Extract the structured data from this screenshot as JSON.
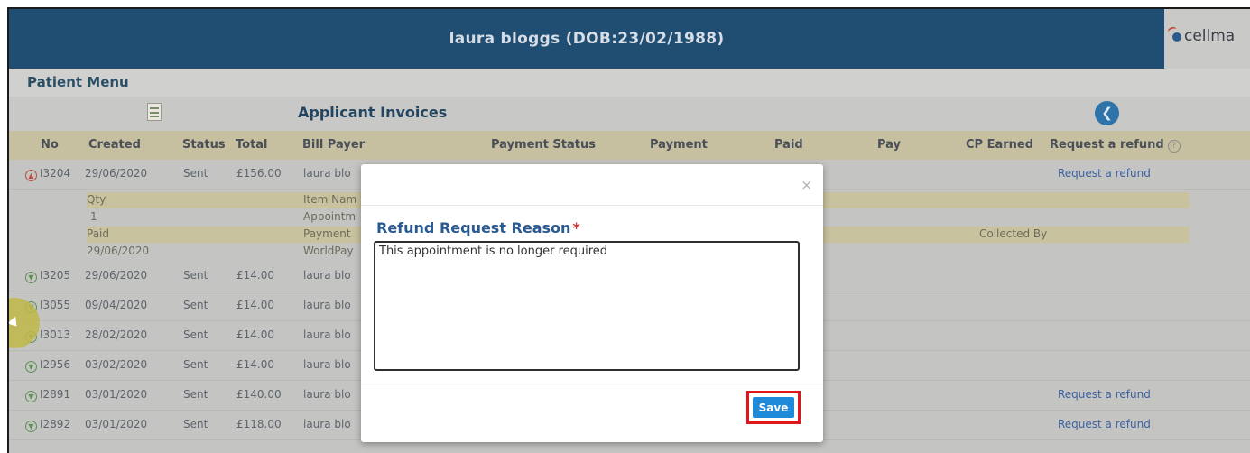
{
  "header": {
    "patient_title": "laura bloggs (DOB:23/02/1988)",
    "logo_text": "cellma"
  },
  "menu": {
    "title": "Patient Menu"
  },
  "invoices": {
    "title": "Applicant Invoices",
    "columns": [
      "No",
      "Created",
      "Status",
      "Total",
      "Bill Payer",
      "Payment Status",
      "Payment",
      "Paid",
      "Pay",
      "CP Earned",
      "Request a refund"
    ],
    "rows": [
      {
        "no": "I3204",
        "created": "29/06/2020",
        "status": "Sent",
        "total": "£156.00",
        "payer": "laura blo",
        "refund": "Request a refund",
        "expanded": true
      },
      {
        "no": "I3205",
        "created": "29/06/2020",
        "status": "Sent",
        "total": "£14.00",
        "payer": "laura blo",
        "refund": ""
      },
      {
        "no": "I3055",
        "created": "09/04/2020",
        "status": "Sent",
        "total": "£14.00",
        "payer": "laura blo",
        "refund": ""
      },
      {
        "no": "I3013",
        "created": "28/02/2020",
        "status": "Sent",
        "total": "£14.00",
        "payer": "laura blo",
        "refund": ""
      },
      {
        "no": "I2956",
        "created": "03/02/2020",
        "status": "Sent",
        "total": "£14.00",
        "payer": "laura blo",
        "refund": ""
      },
      {
        "no": "I2891",
        "created": "03/01/2020",
        "status": "Sent",
        "total": "£140.00",
        "payer": "laura blo",
        "refund": "Request a refund"
      },
      {
        "no": "I2892",
        "created": "03/01/2020",
        "status": "Sent",
        "total": "£118.00",
        "payer": "laura blo",
        "refund": "Request a refund"
      }
    ],
    "detail": {
      "qty_label": "Qty",
      "item_label": "Item Nam",
      "qty_value": "1",
      "item_value": "Appointm",
      "paid_label": "Paid",
      "payment_label": "Payment",
      "collected_label": "Collected By",
      "paid_value": "29/06/2020",
      "payment_value": "WorldPay"
    }
  },
  "modal": {
    "label": "Refund Request Reason",
    "required_mark": "*",
    "close_symbol": "×",
    "reason_value": "This appointment is no longer required",
    "save_label": "Save"
  }
}
